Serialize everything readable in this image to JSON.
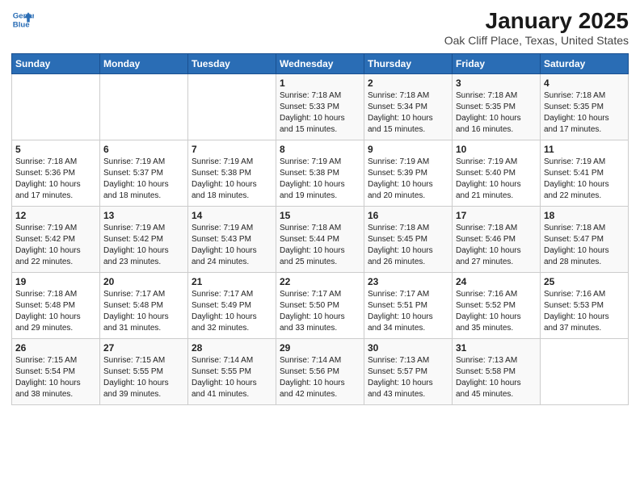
{
  "header": {
    "logo_line1": "General",
    "logo_line2": "Blue",
    "title": "January 2025",
    "subtitle": "Oak Cliff Place, Texas, United States"
  },
  "weekdays": [
    "Sunday",
    "Monday",
    "Tuesday",
    "Wednesday",
    "Thursday",
    "Friday",
    "Saturday"
  ],
  "weeks": [
    [
      {
        "day": "",
        "text": ""
      },
      {
        "day": "",
        "text": ""
      },
      {
        "day": "",
        "text": ""
      },
      {
        "day": "1",
        "text": "Sunrise: 7:18 AM\nSunset: 5:33 PM\nDaylight: 10 hours\nand 15 minutes."
      },
      {
        "day": "2",
        "text": "Sunrise: 7:18 AM\nSunset: 5:34 PM\nDaylight: 10 hours\nand 15 minutes."
      },
      {
        "day": "3",
        "text": "Sunrise: 7:18 AM\nSunset: 5:35 PM\nDaylight: 10 hours\nand 16 minutes."
      },
      {
        "day": "4",
        "text": "Sunrise: 7:18 AM\nSunset: 5:35 PM\nDaylight: 10 hours\nand 17 minutes."
      }
    ],
    [
      {
        "day": "5",
        "text": "Sunrise: 7:18 AM\nSunset: 5:36 PM\nDaylight: 10 hours\nand 17 minutes."
      },
      {
        "day": "6",
        "text": "Sunrise: 7:19 AM\nSunset: 5:37 PM\nDaylight: 10 hours\nand 18 minutes."
      },
      {
        "day": "7",
        "text": "Sunrise: 7:19 AM\nSunset: 5:38 PM\nDaylight: 10 hours\nand 18 minutes."
      },
      {
        "day": "8",
        "text": "Sunrise: 7:19 AM\nSunset: 5:38 PM\nDaylight: 10 hours\nand 19 minutes."
      },
      {
        "day": "9",
        "text": "Sunrise: 7:19 AM\nSunset: 5:39 PM\nDaylight: 10 hours\nand 20 minutes."
      },
      {
        "day": "10",
        "text": "Sunrise: 7:19 AM\nSunset: 5:40 PM\nDaylight: 10 hours\nand 21 minutes."
      },
      {
        "day": "11",
        "text": "Sunrise: 7:19 AM\nSunset: 5:41 PM\nDaylight: 10 hours\nand 22 minutes."
      }
    ],
    [
      {
        "day": "12",
        "text": "Sunrise: 7:19 AM\nSunset: 5:42 PM\nDaylight: 10 hours\nand 22 minutes."
      },
      {
        "day": "13",
        "text": "Sunrise: 7:19 AM\nSunset: 5:42 PM\nDaylight: 10 hours\nand 23 minutes."
      },
      {
        "day": "14",
        "text": "Sunrise: 7:19 AM\nSunset: 5:43 PM\nDaylight: 10 hours\nand 24 minutes."
      },
      {
        "day": "15",
        "text": "Sunrise: 7:18 AM\nSunset: 5:44 PM\nDaylight: 10 hours\nand 25 minutes."
      },
      {
        "day": "16",
        "text": "Sunrise: 7:18 AM\nSunset: 5:45 PM\nDaylight: 10 hours\nand 26 minutes."
      },
      {
        "day": "17",
        "text": "Sunrise: 7:18 AM\nSunset: 5:46 PM\nDaylight: 10 hours\nand 27 minutes."
      },
      {
        "day": "18",
        "text": "Sunrise: 7:18 AM\nSunset: 5:47 PM\nDaylight: 10 hours\nand 28 minutes."
      }
    ],
    [
      {
        "day": "19",
        "text": "Sunrise: 7:18 AM\nSunset: 5:48 PM\nDaylight: 10 hours\nand 29 minutes."
      },
      {
        "day": "20",
        "text": "Sunrise: 7:17 AM\nSunset: 5:48 PM\nDaylight: 10 hours\nand 31 minutes."
      },
      {
        "day": "21",
        "text": "Sunrise: 7:17 AM\nSunset: 5:49 PM\nDaylight: 10 hours\nand 32 minutes."
      },
      {
        "day": "22",
        "text": "Sunrise: 7:17 AM\nSunset: 5:50 PM\nDaylight: 10 hours\nand 33 minutes."
      },
      {
        "day": "23",
        "text": "Sunrise: 7:17 AM\nSunset: 5:51 PM\nDaylight: 10 hours\nand 34 minutes."
      },
      {
        "day": "24",
        "text": "Sunrise: 7:16 AM\nSunset: 5:52 PM\nDaylight: 10 hours\nand 35 minutes."
      },
      {
        "day": "25",
        "text": "Sunrise: 7:16 AM\nSunset: 5:53 PM\nDaylight: 10 hours\nand 37 minutes."
      }
    ],
    [
      {
        "day": "26",
        "text": "Sunrise: 7:15 AM\nSunset: 5:54 PM\nDaylight: 10 hours\nand 38 minutes."
      },
      {
        "day": "27",
        "text": "Sunrise: 7:15 AM\nSunset: 5:55 PM\nDaylight: 10 hours\nand 39 minutes."
      },
      {
        "day": "28",
        "text": "Sunrise: 7:14 AM\nSunset: 5:55 PM\nDaylight: 10 hours\nand 41 minutes."
      },
      {
        "day": "29",
        "text": "Sunrise: 7:14 AM\nSunset: 5:56 PM\nDaylight: 10 hours\nand 42 minutes."
      },
      {
        "day": "30",
        "text": "Sunrise: 7:13 AM\nSunset: 5:57 PM\nDaylight: 10 hours\nand 43 minutes."
      },
      {
        "day": "31",
        "text": "Sunrise: 7:13 AM\nSunset: 5:58 PM\nDaylight: 10 hours\nand 45 minutes."
      },
      {
        "day": "",
        "text": ""
      }
    ]
  ]
}
